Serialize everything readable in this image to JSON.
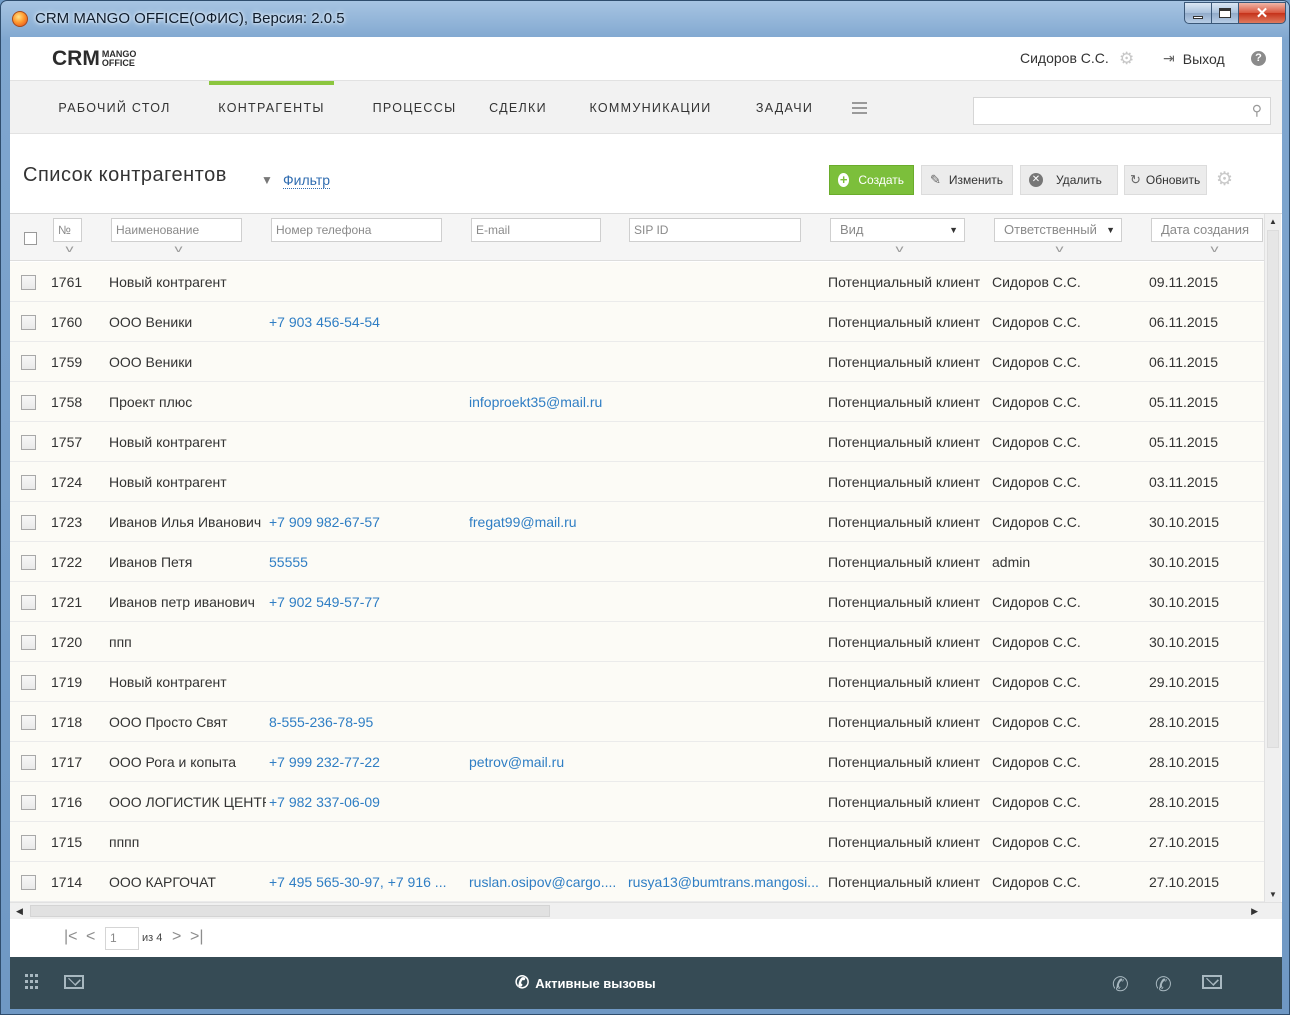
{
  "window": {
    "title": "CRM MANGO OFFICE(ОФИС), Версия: 2.0.5"
  },
  "header": {
    "logo_main": "CRM",
    "logo_sub_1": "MANGO",
    "logo_sub_2": "OFFICE",
    "user": "Сидоров С.С.",
    "logout": "Выход",
    "help": "?"
  },
  "nav": {
    "items": [
      {
        "label": "РАБОЧИЙ СТОЛ"
      },
      {
        "label": "КОНТРАГЕНТЫ"
      },
      {
        "label": "ПРОЦЕССЫ"
      },
      {
        "label": "СДЕЛКИ"
      },
      {
        "label": "КОММУНИКАЦИИ"
      },
      {
        "label": "ЗАДАЧИ"
      }
    ],
    "active_index": 1,
    "search_placeholder": ""
  },
  "page": {
    "title": "Список контрагентов",
    "filter": "Фильтр"
  },
  "toolbar": {
    "create": "Создать",
    "edit": "Изменить",
    "delete": "Удалить",
    "refresh": "Обновить"
  },
  "grid": {
    "columns": {
      "num": "№",
      "name": "Наименование",
      "phone": "Номер телефона",
      "email": "E-mail",
      "sip": "SIP ID",
      "kind": "Вид",
      "owner": "Ответственный",
      "created": "Дата создания"
    },
    "rows": [
      {
        "num": "1761",
        "name": "Новый контрагент",
        "phone": "",
        "email": "",
        "sip": "",
        "kind": "Потенциальный клиент",
        "owner": "Сидоров С.С.",
        "created": "09.11.2015"
      },
      {
        "num": "1760",
        "name": "ООО Веники",
        "phone": "+7 903 456-54-54",
        "email": "",
        "sip": "",
        "kind": "Потенциальный клиент",
        "owner": "Сидоров С.С.",
        "created": "06.11.2015"
      },
      {
        "num": "1759",
        "name": "ООО Веники",
        "phone": "",
        "email": "",
        "sip": "",
        "kind": "Потенциальный клиент",
        "owner": "Сидоров С.С.",
        "created": "06.11.2015"
      },
      {
        "num": "1758",
        "name": "Проект плюс",
        "phone": "",
        "email": "infoproekt35@mail.ru",
        "sip": "",
        "kind": "Потенциальный клиент",
        "owner": "Сидоров С.С.",
        "created": "05.11.2015"
      },
      {
        "num": "1757",
        "name": "Новый контрагент",
        "phone": "",
        "email": "",
        "sip": "",
        "kind": "Потенциальный клиент",
        "owner": "Сидоров С.С.",
        "created": "05.11.2015"
      },
      {
        "num": "1724",
        "name": "Новый контрагент",
        "phone": "",
        "email": "",
        "sip": "",
        "kind": "Потенциальный клиент",
        "owner": "Сидоров С.С.",
        "created": "03.11.2015"
      },
      {
        "num": "1723",
        "name": "Иванов Илья Иванович",
        "phone": "+7 909 982-67-57",
        "email": "fregat99@mail.ru",
        "sip": "",
        "kind": "Потенциальный клиент",
        "owner": "Сидоров С.С.",
        "created": "30.10.2015"
      },
      {
        "num": "1722",
        "name": "Иванов Петя",
        "phone": "55555",
        "email": "",
        "sip": "",
        "kind": "Потенциальный клиент",
        "owner": "admin",
        "created": "30.10.2015"
      },
      {
        "num": "1721",
        "name": "Иванов петр иванович",
        "phone": "+7 902 549-57-77",
        "email": "",
        "sip": "",
        "kind": "Потенциальный клиент",
        "owner": "Сидоров С.С.",
        "created": "30.10.2015"
      },
      {
        "num": "1720",
        "name": "ппп",
        "phone": "",
        "email": "",
        "sip": "",
        "kind": "Потенциальный клиент",
        "owner": "Сидоров С.С.",
        "created": "30.10.2015"
      },
      {
        "num": "1719",
        "name": "Новый контрагент",
        "phone": "",
        "email": "",
        "sip": "",
        "kind": "Потенциальный клиент",
        "owner": "Сидоров С.С.",
        "created": "29.10.2015"
      },
      {
        "num": "1718",
        "name": "ООО Просто Свят",
        "phone": "8-555-236-78-95",
        "email": "",
        "sip": "",
        "kind": "Потенциальный клиент",
        "owner": "Сидоров С.С.",
        "created": "28.10.2015"
      },
      {
        "num": "1717",
        "name": "ООО Рога и копыта",
        "phone": "+7 999 232-77-22",
        "email": "petrov@mail.ru",
        "sip": "",
        "kind": "Потенциальный клиент",
        "owner": "Сидоров С.С.",
        "created": "28.10.2015"
      },
      {
        "num": "1716",
        "name": "ООО ЛОГИСТИК ЦЕНТР",
        "phone": "+7 982 337-06-09",
        "email": "",
        "sip": "",
        "kind": "Потенциальный клиент",
        "owner": "Сидоров С.С.",
        "created": "28.10.2015"
      },
      {
        "num": "1715",
        "name": "пппп",
        "phone": "",
        "email": "",
        "sip": "",
        "kind": "Потенциальный клиент",
        "owner": "Сидоров С.С.",
        "created": "27.10.2015"
      },
      {
        "num": "1714",
        "name": "ООО КАРГОЧАТ",
        "phone": "+7 495 565-30-97, +7 916 ...",
        "email": "ruslan.osipov@cargo....",
        "sip": "rusya13@bumtrans.mangosi...",
        "kind": "Потенциальный клиент",
        "owner": "Сидоров С.С.",
        "created": "27.10.2015"
      }
    ]
  },
  "pager": {
    "page": "1",
    "of": "из 4"
  },
  "callbar": {
    "active_calls": "Активные вызовы"
  },
  "colors": {
    "accent": "#8cc63f",
    "create_button": "#7cbf3b",
    "link": "#2f7ec4",
    "callbar": "#364b55"
  }
}
